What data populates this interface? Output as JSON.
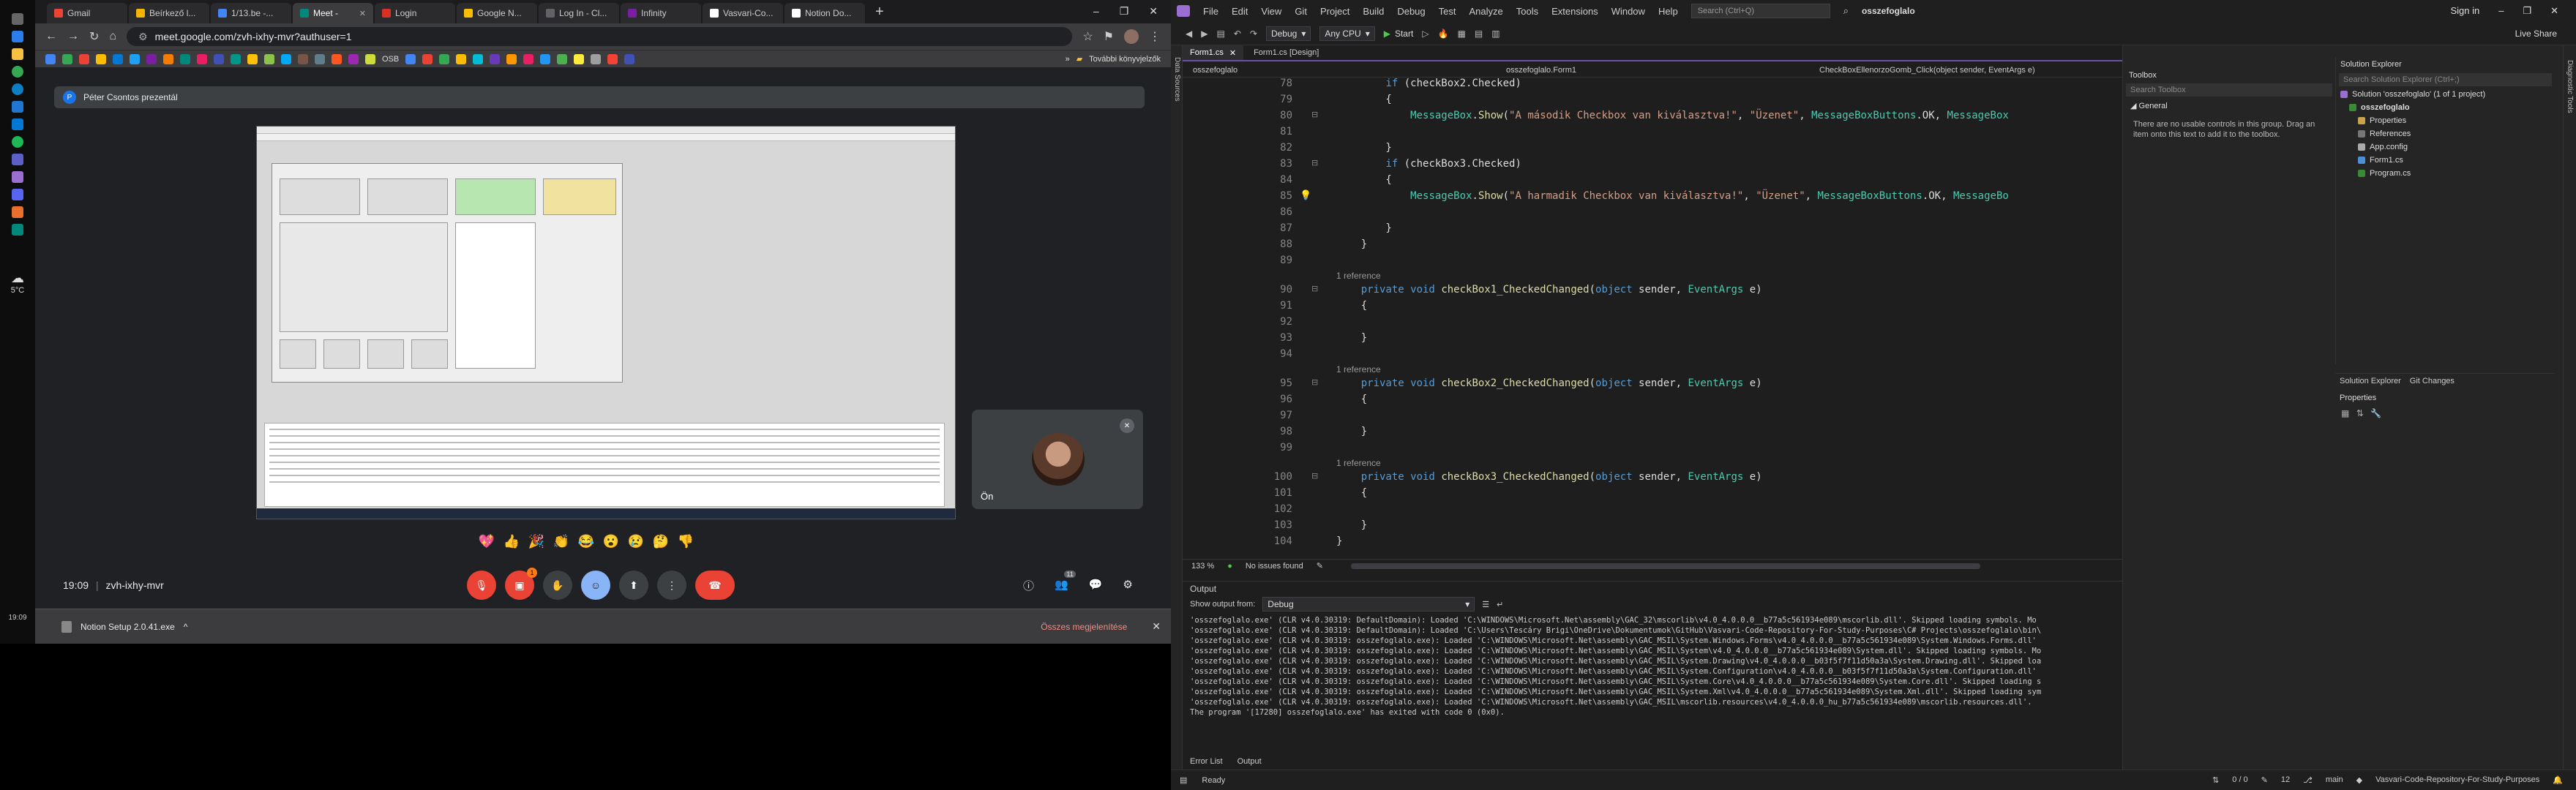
{
  "browser": {
    "tabs": [
      {
        "label": "Gmail",
        "color": "#ea4335"
      },
      {
        "label": "Beírkező l...",
        "color": "#f4b400"
      },
      {
        "label": "1/13.be -...",
        "color": "#4285f4"
      },
      {
        "label": "Meet -",
        "color": "#00897b",
        "active": true
      },
      {
        "label": "Login",
        "color": "#d93025"
      },
      {
        "label": "Google N...",
        "color": "#fbbc04"
      },
      {
        "label": "Log In - Cl...",
        "color": "#5f6368"
      },
      {
        "label": "Infinity",
        "color": "#7b1fa2"
      },
      {
        "label": "Vasvari-Co...",
        "color": "#ffffff"
      },
      {
        "label": "Notion Do...",
        "color": "#ffffff"
      }
    ],
    "url": "meet.google.com/zvh-ixhy-mvr?authuser=1",
    "bookmarks_more": "További könyvjelzők",
    "bookmark_folder": "OSB"
  },
  "meet": {
    "presenter_initial": "P",
    "presenter_banner": "Péter Csontos prezentál",
    "self_name": "Ön",
    "meeting_code": "19:09  |  zvh-ixhy-mvr",
    "time": "19:09",
    "code": "zvh-ixhy-mvr",
    "reactions": [
      "💖",
      "👍",
      "🎉",
      "👏",
      "😂",
      "😮",
      "😢",
      "🤔",
      "👎"
    ],
    "people_count": "11",
    "raise_badge": "1"
  },
  "downloads": {
    "file": "Notion Setup 2.0.41.exe",
    "show_all": "Összes megjelenítése"
  },
  "left_taskbar": {
    "temp": "5°C",
    "clock": "19:09"
  },
  "vs": {
    "menu": [
      "File",
      "Edit",
      "View",
      "Git",
      "Project",
      "Build",
      "Debug",
      "Test",
      "Analyze",
      "Tools",
      "Extensions",
      "Window",
      "Help"
    ],
    "search_placeholder": "Search (Ctrl+Q)",
    "solution_title": "osszefoglalo",
    "sign_in": "Sign in",
    "live_share": "Live Share",
    "config": "Debug",
    "platform": "Any CPU",
    "start": "Start",
    "data_sources": "Data Sources",
    "diagnostic_tools": "Diagnostic Tools",
    "doc_tabs": [
      {
        "label": "Form1.cs",
        "active": true
      },
      {
        "label": "Form1.cs [Design]",
        "active": false
      }
    ],
    "nav": {
      "project": "osszefoglalo",
      "class": "osszefoglalo.Form1",
      "member": "CheckBoxEllenorzoGomb_Click(object sender, EventArgs e)"
    },
    "zoom": "133 %",
    "issues": "No issues found",
    "output": {
      "title": "Output",
      "show_from_label": "Show output from:",
      "show_from": "Debug",
      "lines": [
        "'osszefoglalo.exe' (CLR v4.0.30319: DefaultDomain): Loaded 'C:\\WINDOWS\\Microsoft.Net\\assembly\\GAC_32\\mscorlib\\v4.0_4.0.0.0__b77a5c561934e089\\mscorlib.dll'. Skipped loading symbols. Mo",
        "'osszefoglalo.exe' (CLR v4.0.30319: DefaultDomain): Loaded 'C:\\Users\\Tescáry Brigi\\OneDrive\\Dokumentumok\\GitHub\\Vasvari-Code-Repository-For-Study-Purposes\\C# Projects\\osszefoglalo\\bin\\",
        "'osszefoglalo.exe' (CLR v4.0.30319: osszefoglalo.exe): Loaded 'C:\\WINDOWS\\Microsoft.Net\\assembly\\GAC_MSIL\\System.Windows.Forms\\v4.0_4.0.0.0__b77a5c561934e089\\System.Windows.Forms.dll'",
        "'osszefoglalo.exe' (CLR v4.0.30319: osszefoglalo.exe): Loaded 'C:\\WINDOWS\\Microsoft.Net\\assembly\\GAC_MSIL\\System\\v4.0_4.0.0.0__b77a5c561934e089\\System.dll'. Skipped loading symbols. Mo",
        "'osszefoglalo.exe' (CLR v4.0.30319: osszefoglalo.exe): Loaded 'C:\\WINDOWS\\Microsoft.Net\\assembly\\GAC_MSIL\\System.Drawing\\v4.0_4.0.0.0__b03f5f7f11d50a3a\\System.Drawing.dll'. Skipped loa",
        "'osszefoglalo.exe' (CLR v4.0.30319: osszefoglalo.exe): Loaded 'C:\\WINDOWS\\Microsoft.Net\\assembly\\GAC_MSIL\\System.Configuration\\v4.0_4.0.0.0__b03f5f7f11d50a3a\\System.Configuration.dll'",
        "'osszefoglalo.exe' (CLR v4.0.30319: osszefoglalo.exe): Loaded 'C:\\WINDOWS\\Microsoft.Net\\assembly\\GAC_MSIL\\System.Core\\v4.0_4.0.0.0__b77a5c561934e089\\System.Core.dll'. Skipped loading s",
        "'osszefoglalo.exe' (CLR v4.0.30319: osszefoglalo.exe): Loaded 'C:\\WINDOWS\\Microsoft.Net\\assembly\\GAC_MSIL\\System.Xml\\v4.0_4.0.0.0__b77a5c561934e089\\System.Xml.dll'. Skipped loading sym",
        "'osszefoglalo.exe' (CLR v4.0.30319: osszefoglalo.exe): Loaded 'C:\\WINDOWS\\Microsoft.Net\\assembly\\GAC_MSIL\\mscorlib.resources\\v4.0_4.0.0.0_hu_b77a5c561934e089\\mscorlib.resources.dll'.",
        "The program '[17280] osszefoglalo.exe' has exited with code 0 (0x0)."
      ]
    },
    "bottom_tabs": [
      "Error List",
      "Output"
    ],
    "toolbox": {
      "title": "Toolbox",
      "search": "Search Toolbox",
      "group": "General",
      "message": "There are no usable controls in this group. Drag an item onto this text to add it to the toolbox."
    },
    "solution_explorer": {
      "title": "Solution Explorer",
      "search": "Search Solution Explorer (Ctrl+;)",
      "items": [
        {
          "label": "Solution 'osszefoglalo' (1 of 1 project)",
          "indent": 0
        },
        {
          "label": "osszefoglalo",
          "indent": 1
        },
        {
          "label": "Properties",
          "indent": 2
        },
        {
          "label": "References",
          "indent": 2
        },
        {
          "label": "App.config",
          "indent": 2
        },
        {
          "label": "Form1.cs",
          "indent": 2
        },
        {
          "label": "Program.cs",
          "indent": 2
        }
      ],
      "tabs": [
        "Solution Explorer",
        "Git Changes"
      ]
    },
    "properties_title": "Properties",
    "status": {
      "ready": "Ready",
      "errors": "0 / 0",
      "changes": "12",
      "branch": "main",
      "repo": "Vasvari-Code-Repository-For-Study-Purposes"
    }
  },
  "code_lines": [
    {
      "n": "78",
      "t": "code",
      "html": "        <span class=\"kw\">if</span> (checkBox2.Checked)"
    },
    {
      "n": "79",
      "t": "code",
      "html": "        {"
    },
    {
      "n": "80",
      "t": "code",
      "html": "            <span class=\"typ\">MessageBox</span>.<span class=\"mth\">Show</span>(<span class=\"str\">\"A második Checkbox van kiválasztva!\"</span>, <span class=\"str\">\"Üzenet\"</span>, <span class=\"typ\">MessageBoxButtons</span>.OK, <span class=\"typ\">MessageBox</span>"
    },
    {
      "n": "81",
      "t": "code",
      "html": ""
    },
    {
      "n": "82",
      "t": "code",
      "html": "        }"
    },
    {
      "n": "83",
      "t": "code",
      "html": "        <span class=\"kw\">if</span> (checkBox3.Checked)"
    },
    {
      "n": "84",
      "t": "code",
      "html": "        {"
    },
    {
      "n": "85",
      "t": "code",
      "html": "            <span class=\"typ\">MessageBox</span>.<span class=\"mth\">Show</span>(<span class=\"str\">\"A harmadik Checkbox van kiválasztva!\"</span>, <span class=\"str\">\"Üzenet\"</span>, <span class=\"typ\">MessageBoxButtons</span>.OK, <span class=\"typ\">MessageBo</span>"
    },
    {
      "n": "86",
      "t": "code",
      "html": ""
    },
    {
      "n": "87",
      "t": "code",
      "html": "        }"
    },
    {
      "n": "88",
      "t": "code",
      "html": "    }"
    },
    {
      "n": "89",
      "t": "code",
      "html": ""
    },
    {
      "n": "",
      "t": "ref",
      "html": "1 reference"
    },
    {
      "n": "90",
      "t": "code",
      "html": "    <span class=\"kw\">private void</span> <span class=\"mth\">checkBox1_CheckedChanged</span>(<span class=\"kw\">object</span> sender, <span class=\"typ\">EventArgs</span> e)"
    },
    {
      "n": "91",
      "t": "code",
      "html": "    {"
    },
    {
      "n": "92",
      "t": "code",
      "html": ""
    },
    {
      "n": "93",
      "t": "code",
      "html": "    }"
    },
    {
      "n": "94",
      "t": "code",
      "html": ""
    },
    {
      "n": "",
      "t": "ref",
      "html": "1 reference"
    },
    {
      "n": "95",
      "t": "code",
      "html": "    <span class=\"kw\">private void</span> <span class=\"mth\">checkBox2_CheckedChanged</span>(<span class=\"kw\">object</span> sender, <span class=\"typ\">EventArgs</span> e)"
    },
    {
      "n": "96",
      "t": "code",
      "html": "    {"
    },
    {
      "n": "97",
      "t": "code",
      "html": ""
    },
    {
      "n": "98",
      "t": "code",
      "html": "    }"
    },
    {
      "n": "99",
      "t": "code",
      "html": ""
    },
    {
      "n": "",
      "t": "ref",
      "html": "1 reference"
    },
    {
      "n": "100",
      "t": "code",
      "html": "    <span class=\"kw\">private void</span> <span class=\"mth\">checkBox3_CheckedChanged</span>(<span class=\"kw\">object</span> sender, <span class=\"typ\">EventArgs</span> e)"
    },
    {
      "n": "101",
      "t": "code",
      "html": "    {"
    },
    {
      "n": "102",
      "t": "code",
      "html": ""
    },
    {
      "n": "103",
      "t": "code",
      "html": "    }"
    },
    {
      "n": "104",
      "t": "code",
      "html": "}"
    }
  ],
  "colors": {
    "vs_accent": "#6b4fa8",
    "meet_hangup": "#ea4335",
    "meet_bg": "#202124"
  }
}
